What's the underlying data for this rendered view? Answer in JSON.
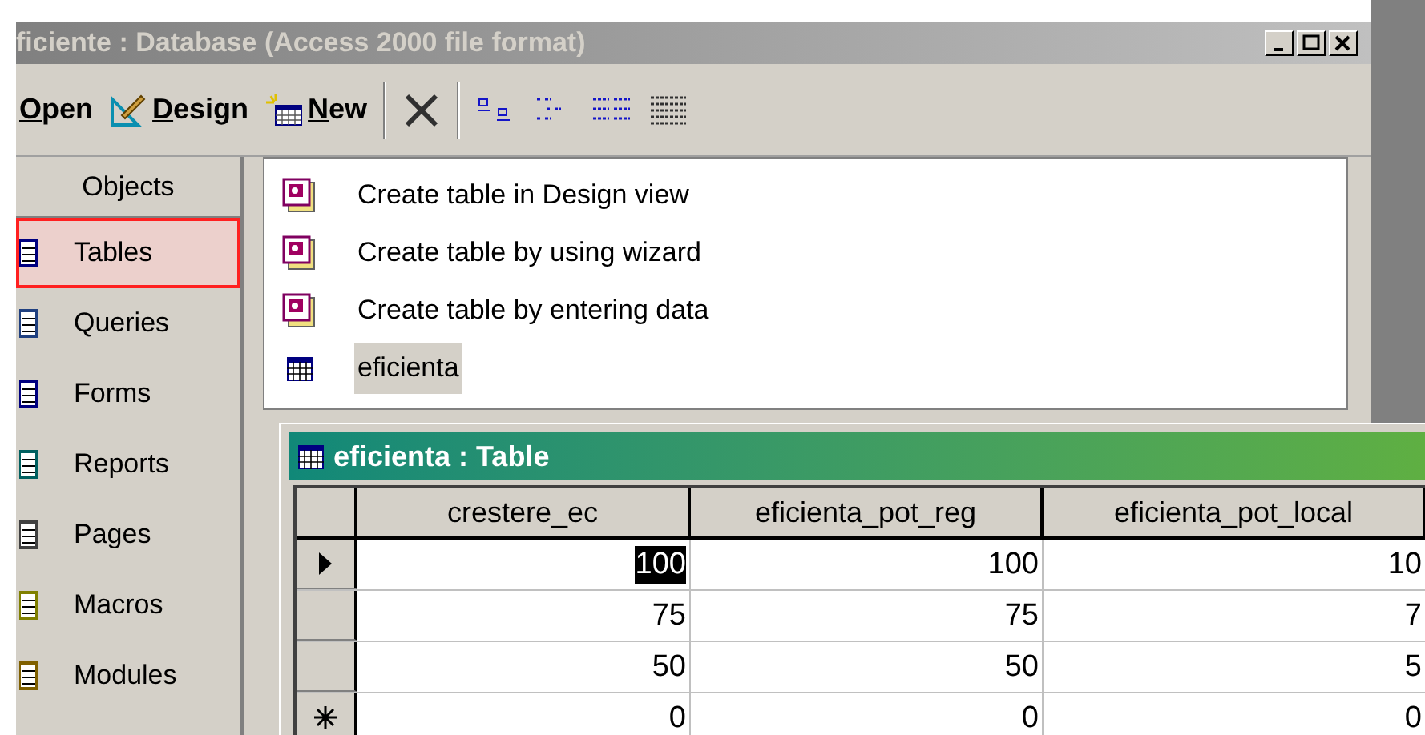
{
  "window": {
    "title": "ficiente : Database (Access 2000 file format)"
  },
  "toolbar": [
    {
      "label": "Open",
      "kind": "open"
    },
    {
      "label": "Design",
      "kind": "design"
    },
    {
      "label": "New",
      "kind": "new"
    },
    {
      "kind": "delete"
    },
    {
      "kind": "large-icons"
    },
    {
      "kind": "small-icons"
    },
    {
      "kind": "list"
    },
    {
      "kind": "details"
    }
  ],
  "sidebar": {
    "header": "Objects",
    "items": [
      {
        "label": "Tables",
        "selected": true
      },
      {
        "label": "Queries",
        "selected": false
      },
      {
        "label": "Forms",
        "selected": false
      },
      {
        "label": "Reports",
        "selected": false
      },
      {
        "label": "Pages",
        "selected": false
      },
      {
        "label": "Macros",
        "selected": false
      },
      {
        "label": "Modules",
        "selected": false
      }
    ]
  },
  "objects": [
    {
      "label": "Create table in Design view",
      "kind": "shortcut",
      "selected": false
    },
    {
      "label": "Create table by using wizard",
      "kind": "shortcut",
      "selected": false
    },
    {
      "label": "Create table by entering data",
      "kind": "shortcut",
      "selected": false
    },
    {
      "label": "eficienta",
      "kind": "table",
      "selected": true
    }
  ],
  "table_window": {
    "title": "eficienta : Table",
    "columns": [
      "crestere_ec",
      "eficienta_pot_reg",
      "eficienta_pot_local"
    ],
    "rows": [
      {
        "kind": "current",
        "cells": [
          {
            "text": "100",
            "selected": true
          },
          {
            "text": "100",
            "selected": false
          },
          {
            "text": "10",
            "selected": false
          }
        ]
      },
      {
        "kind": "data",
        "cells": [
          {
            "text": "75",
            "selected": false
          },
          {
            "text": "75",
            "selected": false
          },
          {
            "text": "7",
            "selected": false
          }
        ]
      },
      {
        "kind": "data",
        "cells": [
          {
            "text": "50",
            "selected": false
          },
          {
            "text": "50",
            "selected": false
          },
          {
            "text": "5",
            "selected": false
          }
        ]
      },
      {
        "kind": "new",
        "cells": [
          {
            "text": "0",
            "selected": false
          },
          {
            "text": "0",
            "selected": false
          },
          {
            "text": "0",
            "selected": false
          }
        ]
      }
    ]
  }
}
